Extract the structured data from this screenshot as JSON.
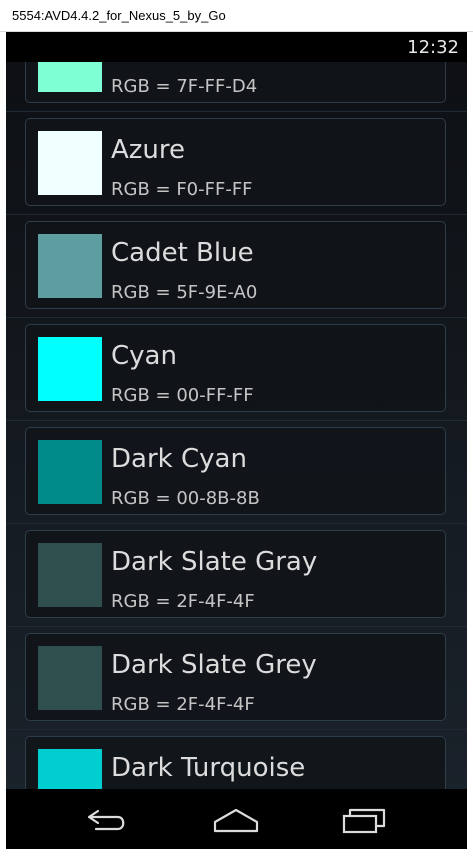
{
  "window": {
    "title": "5554:AVD4.4.2_for_Nexus_5_by_Go"
  },
  "status_bar": {
    "time": "12:32"
  },
  "colors": [
    {
      "name": "",
      "rgb": "RGB = 7F-FF-D4",
      "hex": "#7FFFD4"
    },
    {
      "name": "Azure",
      "rgb": "RGB = F0-FF-FF",
      "hex": "#F0FFFF"
    },
    {
      "name": "Cadet Blue",
      "rgb": "RGB = 5F-9E-A0",
      "hex": "#5F9EA0"
    },
    {
      "name": "Cyan",
      "rgb": "RGB = 00-FF-FF",
      "hex": "#00FFFF"
    },
    {
      "name": "Dark Cyan",
      "rgb": "RGB = 00-8B-8B",
      "hex": "#008B8B"
    },
    {
      "name": "Dark Slate Gray",
      "rgb": "RGB = 2F-4F-4F",
      "hex": "#2F4F4F"
    },
    {
      "name": "Dark Slate Grey",
      "rgb": "RGB = 2F-4F-4F",
      "hex": "#2F4F4F"
    },
    {
      "name": "Dark Turquoise",
      "rgb": "",
      "hex": "#00CED1"
    }
  ],
  "nav_bar": {
    "back_icon": "back-arrow-icon",
    "home_icon": "home-icon",
    "recents_icon": "recent-apps-icon"
  }
}
